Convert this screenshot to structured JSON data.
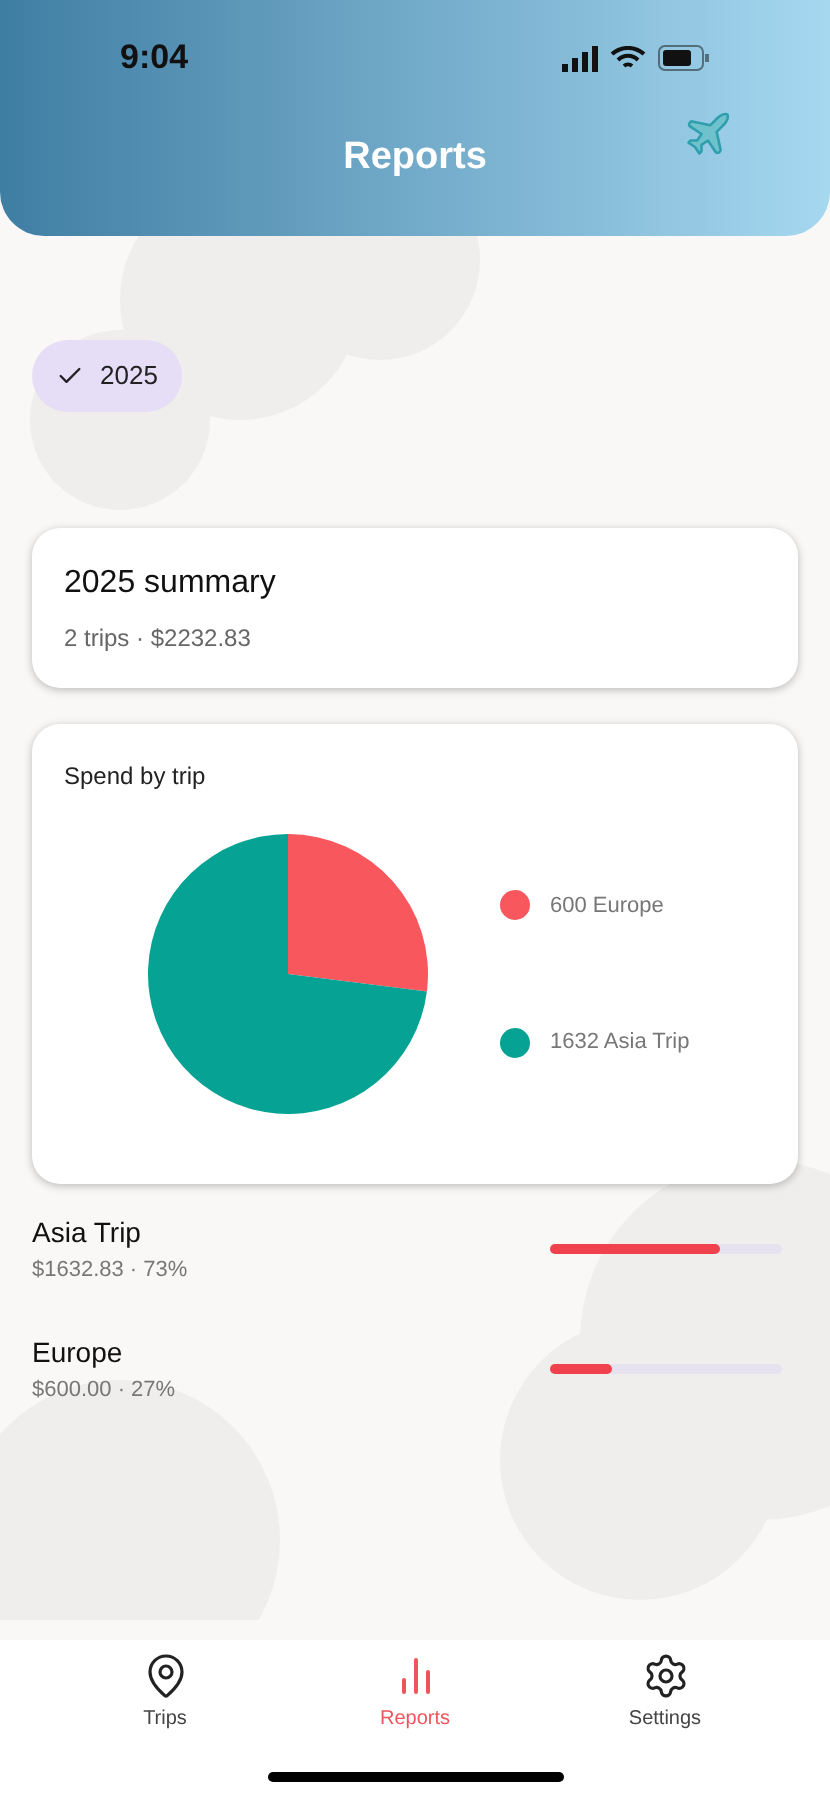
{
  "status_bar": {
    "time": "9:04"
  },
  "header": {
    "title": "Reports"
  },
  "filters": [
    {
      "label": "2025",
      "selected": true
    }
  ],
  "summary": {
    "title": "2025 summary",
    "subtitle": "2 trips · $2232.83"
  },
  "spend_card": {
    "title": "Spend by trip",
    "chart_data": {
      "type": "pie",
      "values": [
        27,
        73
      ]
    },
    "legend": [
      {
        "label": "600 Europe",
        "color": "#f7575d"
      },
      {
        "label": "1632 Asia Trip",
        "color": "#06a293"
      }
    ]
  },
  "trips": [
    {
      "name": "Asia Trip",
      "detail": "$1632.83 · 73%",
      "level": 0.73
    },
    {
      "name": "Europe",
      "detail": "$600.00 · 27%",
      "level": 0.27
    }
  ],
  "tabs": [
    {
      "label": "Trips",
      "kind": "pin",
      "selected": false
    },
    {
      "label": "Reports",
      "kind": "chart",
      "selected": true
    },
    {
      "label": "Settings",
      "kind": "gear",
      "selected": false
    }
  ]
}
